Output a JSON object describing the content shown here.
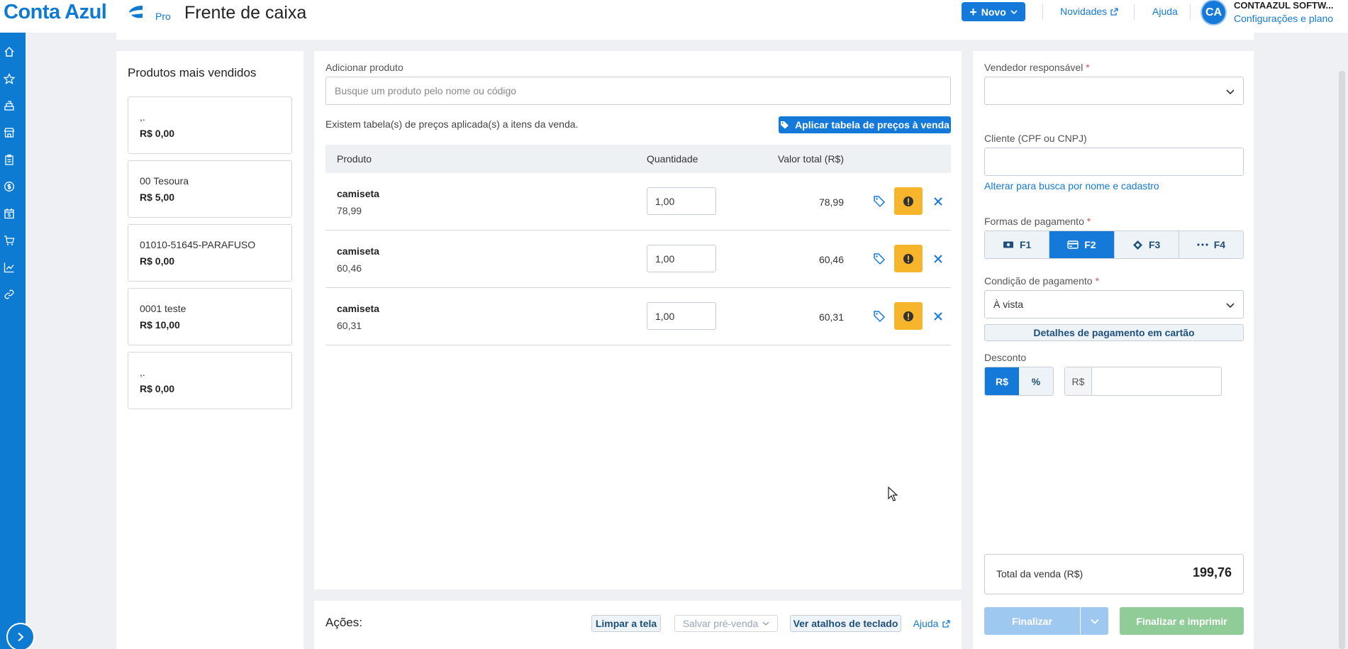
{
  "header": {
    "logo_text": "Conta Azul",
    "logo_badge": "Pro",
    "page_title": "Frente de caixa",
    "new_button": "Novo",
    "links": {
      "news": "Novidades",
      "help": "Ajuda"
    },
    "user": {
      "initials": "CA",
      "company": "CONTAAZUL SOFTW...",
      "config_link": "Configurações e plano"
    }
  },
  "sidebar": {
    "icons": [
      "home-icon",
      "star-icon",
      "cash-register-icon",
      "store-icon",
      "clipboard-icon",
      "money-icon",
      "calendar-money-icon",
      "cart-icon",
      "chart-icon",
      "link-icon"
    ]
  },
  "top_products": {
    "title": "Produtos mais vendidos",
    "items": [
      {
        "name": ",.",
        "price": "R$ 0,00"
      },
      {
        "name": "00 Tesoura",
        "price": "R$ 5,00"
      },
      {
        "name": "01010-51645-PARAFUSO",
        "price": "R$ 0,00"
      },
      {
        "name": "0001 teste",
        "price": "R$ 10,00"
      },
      {
        "name": ",.",
        "price": "R$ 0,00"
      }
    ]
  },
  "cart": {
    "add_label": "Adicionar produto",
    "search_placeholder": "Busque um produto pelo nome ou código",
    "price_table_info": "Existem tabela(s) de preços aplicada(s) a itens da venda.",
    "apply_button": "Aplicar tabela de preços à venda",
    "columns": {
      "product": "Produto",
      "quantity": "Quantidade",
      "total": "Valor total (R$)"
    },
    "rows": [
      {
        "name": "camiseta",
        "unit_price": "78,99",
        "qty": "1,00",
        "total": "78,99"
      },
      {
        "name": "camiseta",
        "unit_price": "60,46",
        "qty": "1,00",
        "total": "60,46"
      },
      {
        "name": "camiseta",
        "unit_price": "60,31",
        "qty": "1,00",
        "total": "60,31"
      }
    ]
  },
  "actions": {
    "label": "Ações:",
    "clear": "Limpar a tela",
    "save_presale": "Salvar pré-venda",
    "shortcuts": "Ver atalhos de teclado",
    "help": "Ajuda"
  },
  "payment": {
    "seller_label": "Vendedor responsável",
    "required_mark": "*",
    "client_label": "Cliente (CPF ou CNPJ)",
    "client_switch_link": "Alterar para busca por nome e cadastro",
    "methods_label": "Formas de pagamento",
    "methods": [
      {
        "key": "F1",
        "active": false
      },
      {
        "key": "F2",
        "active": true
      },
      {
        "key": "F3",
        "active": false
      },
      {
        "key": "F4",
        "active": false
      }
    ],
    "condition_label": "Condição de pagamento",
    "condition_value": "À vista",
    "card_details": "Detalhes de pagamento em cartão",
    "discount_label": "Desconto",
    "discount_modes": [
      "R$",
      "%"
    ],
    "discount_prefix": "R$",
    "total_label": "Total da venda (R$)",
    "total_value": "199,76",
    "finish": "Finalizar",
    "finish_print": "Finalizar e imprimir"
  },
  "colors": {
    "brand": "#1479d9",
    "sidebar": "#0d7bd2",
    "warning": "#f7b52c",
    "success": "#8fcc98"
  }
}
